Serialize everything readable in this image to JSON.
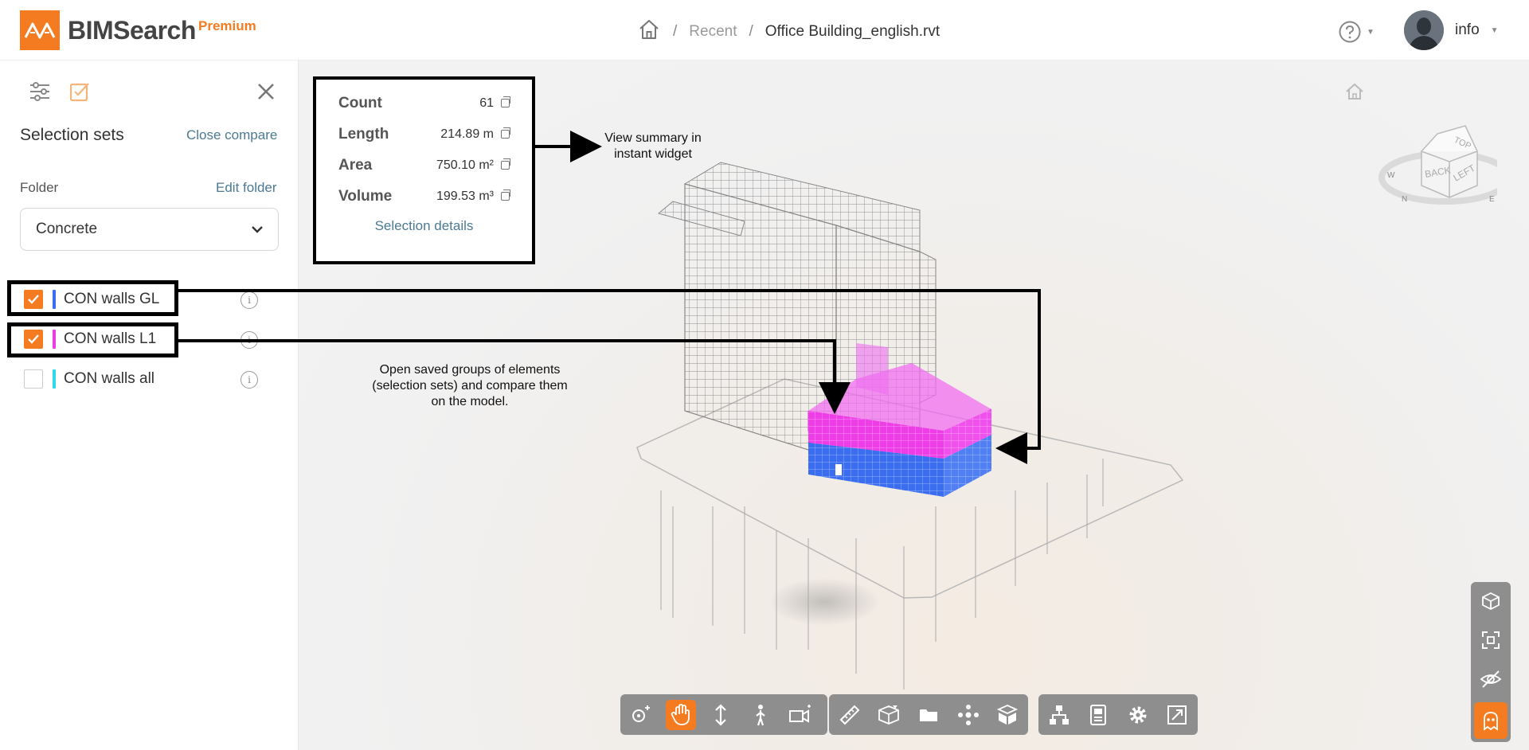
{
  "header": {
    "brand": "BIMSearch",
    "tier": "Premium",
    "breadcrumb": {
      "home_icon": "home-icon",
      "recent": "Recent",
      "current": "Office Building_english.rvt",
      "separator": "/"
    },
    "user": {
      "name": "info"
    },
    "icons": [
      "logo-icon",
      "help-icon",
      "chevron-down-icon",
      "avatar"
    ]
  },
  "panel": {
    "title": "Selection sets",
    "close_compare": "Close compare",
    "folder_label": "Folder",
    "edit_folder": "Edit folder",
    "folder_value": "Concrete",
    "sets": [
      {
        "name": "CON walls GL",
        "checked": true,
        "color": "#3b6df0"
      },
      {
        "name": "CON walls L1",
        "checked": true,
        "color": "#ee3de6"
      },
      {
        "name": "CON walls all",
        "checked": false,
        "color": "#31d9e8"
      }
    ]
  },
  "summary": {
    "rows": [
      {
        "label": "Count",
        "value": "61"
      },
      {
        "label": "Length",
        "value": "214.89 m"
      },
      {
        "label": "Area",
        "value": "750.10 m²"
      },
      {
        "label": "Volume",
        "value": "199.53 m³"
      }
    ],
    "details_link": "Selection details"
  },
  "annotations": {
    "widget_note_1": "View summary in",
    "widget_note_2": "instant widget",
    "sets_note_1": "Open saved groups of elements",
    "sets_note_2": "(selection sets) and compare them",
    "sets_note_3": "on the model."
  },
  "viewcube": {
    "face_top": "TOP",
    "face_back": "BACK",
    "face_left": "LEFT",
    "compass": [
      "N",
      "W",
      "E"
    ]
  },
  "toolbar": {
    "groups": [
      [
        "orbit-icon",
        "pan-icon",
        "zoom-icon",
        "walk-icon",
        "camera-icon"
      ],
      [
        "measure-icon",
        "section-icon",
        "folder-icon",
        "explode-icon",
        "box-icon"
      ],
      [
        "tree-icon",
        "properties-icon",
        "settings-icon",
        "fullscreen-icon"
      ]
    ],
    "active": "pan-icon",
    "side": [
      "cube-view-icon",
      "fit-view-icon",
      "hide-icon",
      "ghost-icon"
    ]
  },
  "colors": {
    "accent": "#f47b20",
    "link": "#4b7a94",
    "toolbar": "#8e8e8e",
    "blue": "#3b6df0",
    "magenta": "#ee3de6"
  }
}
